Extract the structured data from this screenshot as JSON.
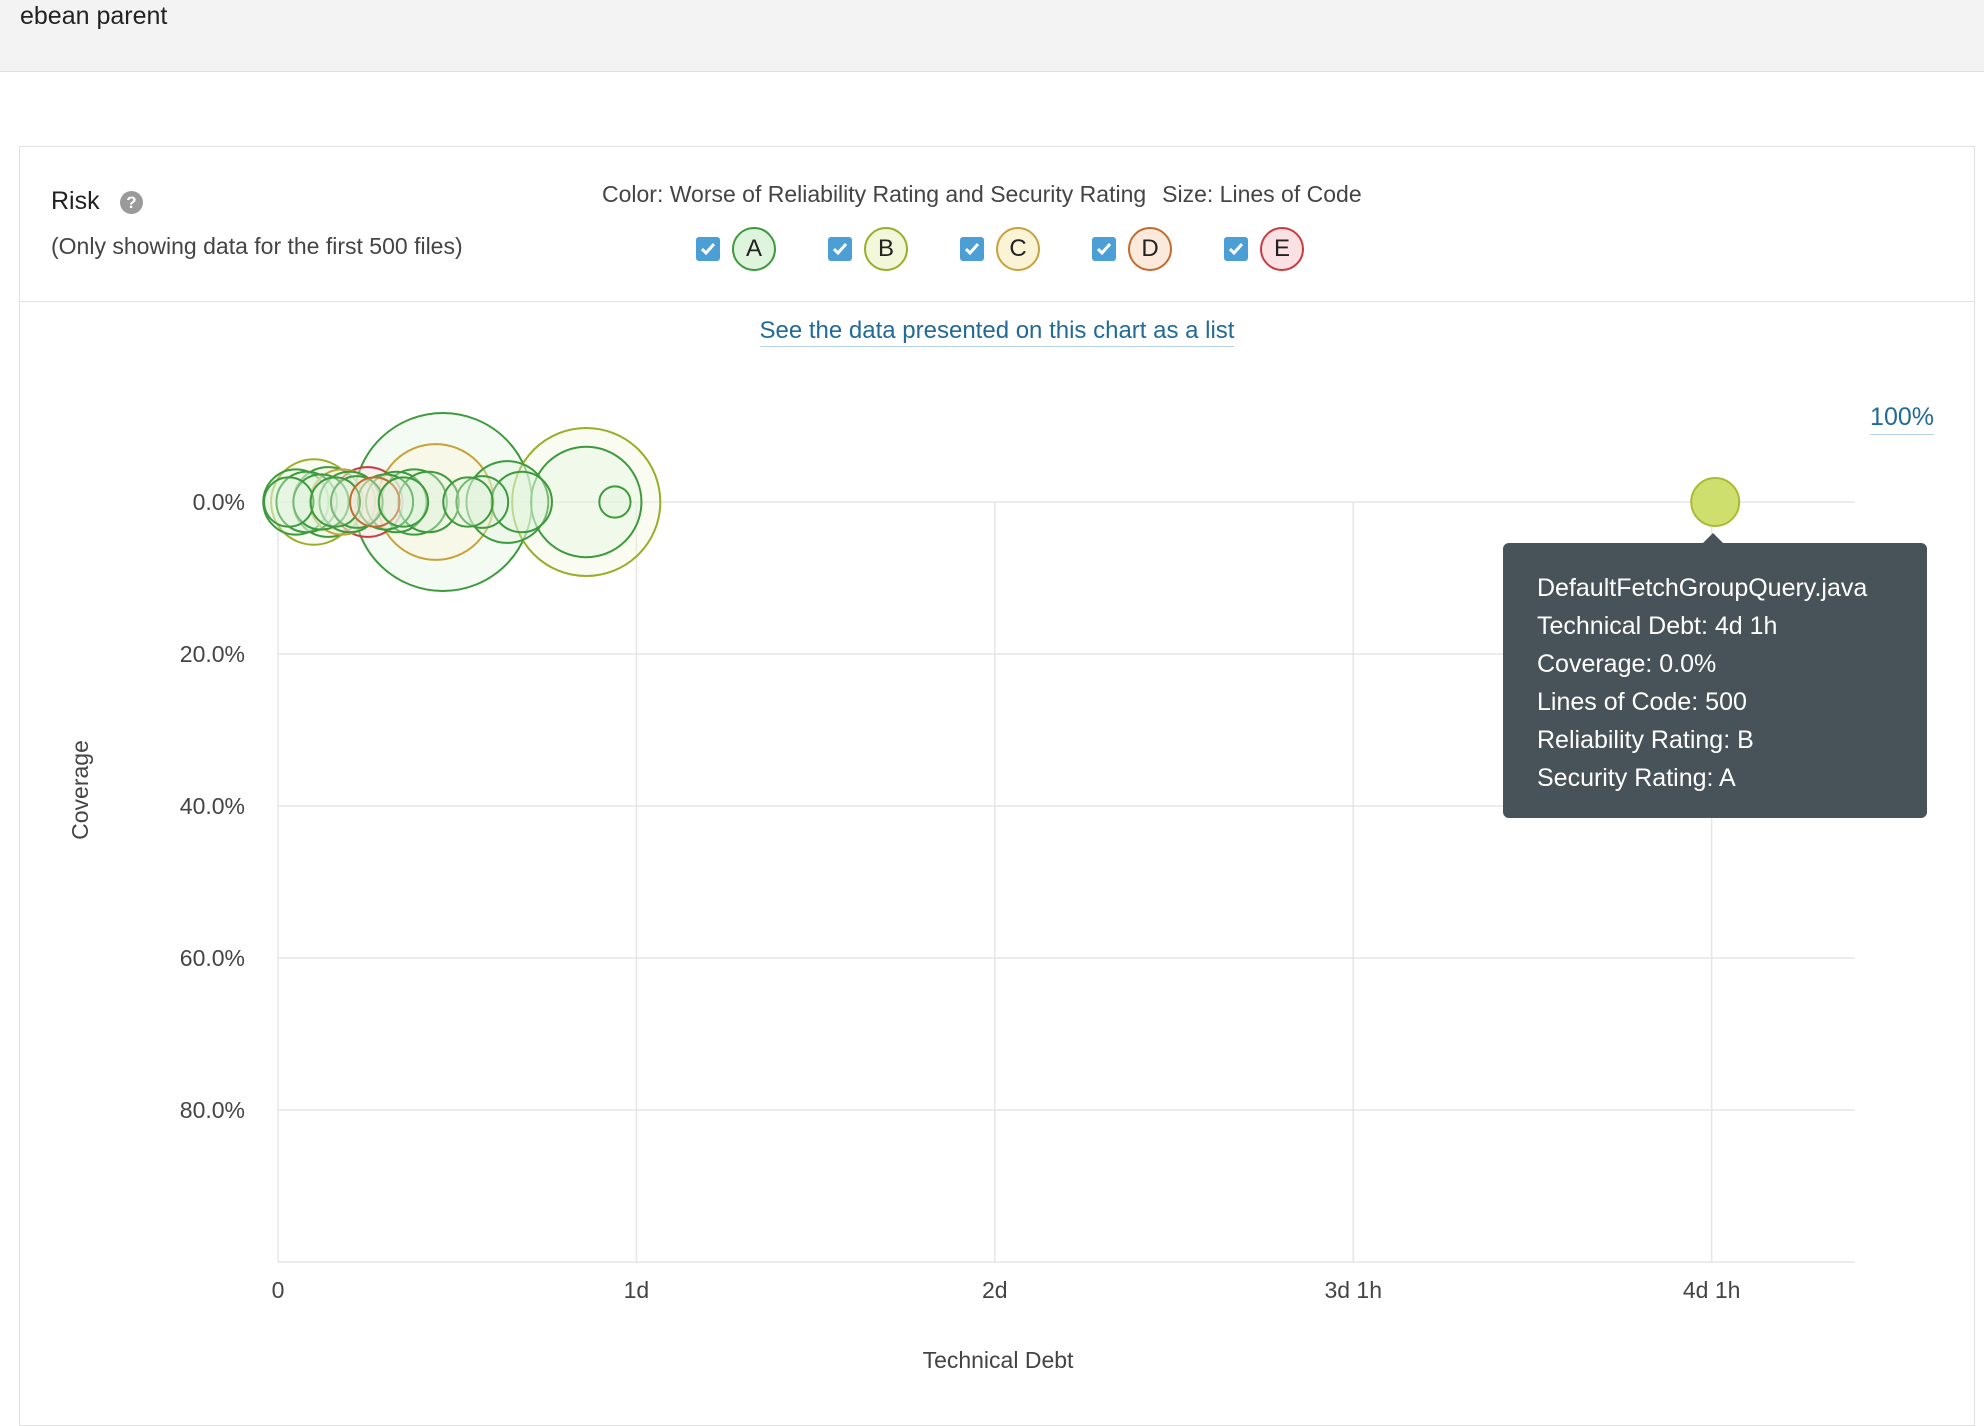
{
  "header": {
    "project_name": "ebean parent"
  },
  "widget": {
    "title": "Risk",
    "help_icon": "question-circle-icon",
    "note": "(Only showing data for the first 500 files)",
    "color_caption": "Color: Worse of Reliability Rating and Security Rating",
    "size_caption": "Size: Lines of Code",
    "list_link": "See the data presented on this chart as a list",
    "zoom_link": "100%"
  },
  "legend": [
    {
      "rating": "A",
      "checked": true,
      "fill": "#dff4dc",
      "stroke": "#3c9a3c"
    },
    {
      "rating": "B",
      "checked": true,
      "fill": "#f1f7d8",
      "stroke": "#9aad27"
    },
    {
      "rating": "C",
      "checked": true,
      "fill": "#fbf3d5",
      "stroke": "#c7a13a"
    },
    {
      "rating": "D",
      "checked": true,
      "fill": "#fbe9dc",
      "stroke": "#c46a2e"
    },
    {
      "rating": "E",
      "checked": true,
      "fill": "#fbe1e3",
      "stroke": "#c93a41"
    }
  ],
  "chart_data": {
    "type": "scatter",
    "xlabel": "Technical Debt",
    "ylabel": "Coverage",
    "x_unit": "days",
    "x_ticks": [
      {
        "value": 0,
        "label": "0"
      },
      {
        "value": 1,
        "label": "1d"
      },
      {
        "value": 2,
        "label": "2d"
      },
      {
        "value": 3,
        "label": "3d 1h"
      },
      {
        "value": 4,
        "label": "4d 1h"
      }
    ],
    "y_ticks": [
      {
        "value": 0,
        "label": "0.0%"
      },
      {
        "value": 20,
        "label": "20.0%"
      },
      {
        "value": 40,
        "label": "40.0%"
      },
      {
        "value": 60,
        "label": "60.0%"
      },
      {
        "value": 80,
        "label": "80.0%"
      }
    ],
    "xlim": [
      0,
      4.4
    ],
    "ylim": [
      0,
      100
    ],
    "y_inverted": true,
    "points": [
      {
        "x": 0.03,
        "y": 0,
        "loc": 20,
        "rating": "A"
      },
      {
        "x": 0.05,
        "y": 0,
        "loc": 35,
        "rating": "A"
      },
      {
        "x": 0.08,
        "y": 0,
        "loc": 30,
        "rating": "A"
      },
      {
        "x": 0.1,
        "y": 0,
        "loc": 60,
        "rating": "B"
      },
      {
        "x": 0.12,
        "y": 0,
        "loc": 25,
        "rating": "A"
      },
      {
        "x": 0.14,
        "y": 0,
        "loc": 40,
        "rating": "A"
      },
      {
        "x": 0.16,
        "y": 0,
        "loc": 20,
        "rating": "A"
      },
      {
        "x": 0.18,
        "y": 0,
        "loc": 35,
        "rating": "C"
      },
      {
        "x": 0.2,
        "y": 0,
        "loc": 30,
        "rating": "A"
      },
      {
        "x": 0.22,
        "y": 0,
        "loc": 22,
        "rating": "A"
      },
      {
        "x": 0.25,
        "y": 0,
        "loc": 40,
        "rating": "E"
      },
      {
        "x": 0.27,
        "y": 0,
        "loc": 20,
        "rating": "D"
      },
      {
        "x": 0.3,
        "y": 0,
        "loc": 25,
        "rating": "A"
      },
      {
        "x": 0.33,
        "y": 0,
        "loc": 30,
        "rating": "A"
      },
      {
        "x": 0.35,
        "y": 0,
        "loc": 20,
        "rating": "A"
      },
      {
        "x": 0.38,
        "y": 0,
        "loc": 35,
        "rating": "A"
      },
      {
        "x": 0.46,
        "y": 0,
        "loc": 260,
        "rating": "A"
      },
      {
        "x": 0.44,
        "y": 0,
        "loc": 110,
        "rating": "C"
      },
      {
        "x": 0.42,
        "y": 0,
        "loc": 30,
        "rating": "A"
      },
      {
        "x": 0.53,
        "y": 0,
        "loc": 20,
        "rating": "A"
      },
      {
        "x": 0.57,
        "y": 0,
        "loc": 22,
        "rating": "A"
      },
      {
        "x": 0.64,
        "y": 0,
        "loc": 55,
        "rating": "A"
      },
      {
        "x": 0.68,
        "y": 0,
        "loc": 30,
        "rating": "A"
      },
      {
        "x": 0.86,
        "y": 0,
        "loc": 180,
        "rating": "B"
      },
      {
        "x": 0.86,
        "y": 0,
        "loc": 100,
        "rating": "A"
      },
      {
        "x": 0.94,
        "y": 0,
        "loc": 8,
        "rating": "A"
      },
      {
        "x": 4.01,
        "y": 0,
        "loc": 18,
        "rating": "B"
      }
    ]
  },
  "tooltip": {
    "file": "DefaultFetchGroupQuery.java",
    "technical_debt": "Technical Debt: 4d 1h",
    "coverage": "Coverage: 0.0%",
    "lines_of_code": "Lines of Code: 500",
    "reliability": "Reliability Rating: B",
    "security": "Security Rating: A"
  }
}
